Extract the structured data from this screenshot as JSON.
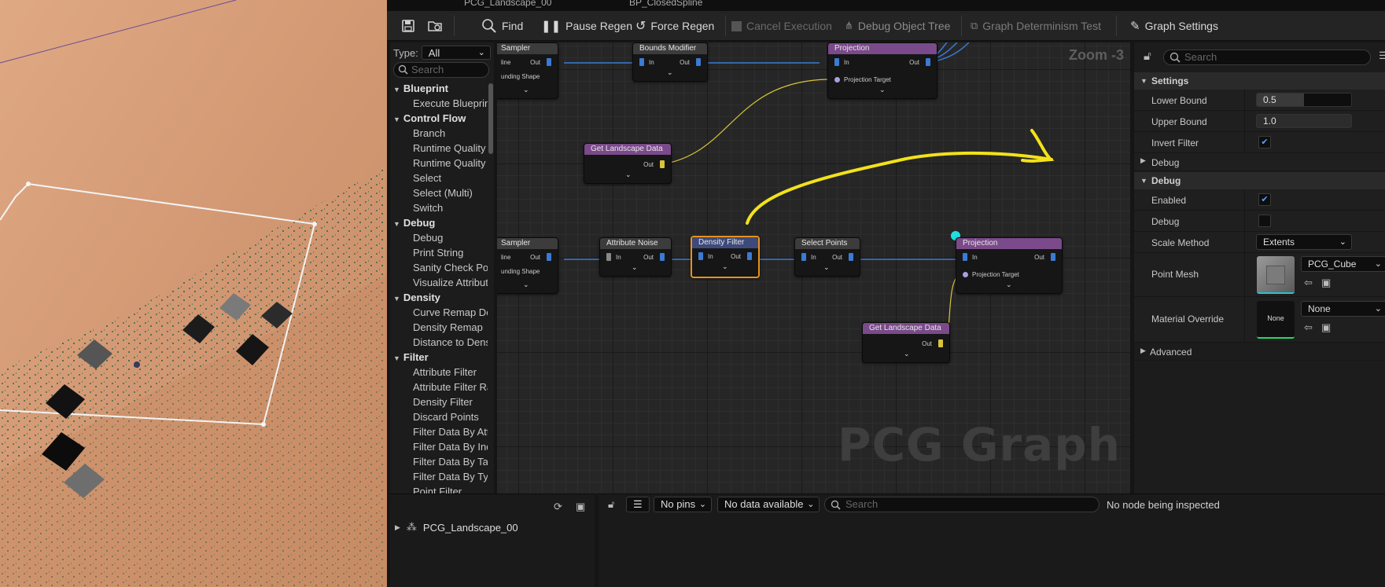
{
  "tabs": [
    {
      "label": "PCG_Landscape_00"
    },
    {
      "label": "BP_ClosedSpline"
    }
  ],
  "toolbar": {
    "find": "Find",
    "pause_regen": "Pause Regen",
    "force_regen": "Force Regen",
    "cancel_execution": "Cancel Execution",
    "debug_object_tree": "Debug Object Tree",
    "graph_determinism_test": "Graph Determinism Test",
    "graph_settings": "Graph Settings"
  },
  "palette": {
    "type_label": "Type:",
    "type_value": "All",
    "search_placeholder": "Search",
    "rows": [
      {
        "kind": "cat",
        "label": "Blueprint"
      },
      {
        "kind": "item",
        "label": "Execute Blueprint"
      },
      {
        "kind": "cat",
        "label": "Control Flow"
      },
      {
        "kind": "item",
        "label": "Branch"
      },
      {
        "kind": "item",
        "label": "Runtime Quality Branch"
      },
      {
        "kind": "item",
        "label": "Runtime Quality Select"
      },
      {
        "kind": "item",
        "label": "Select"
      },
      {
        "kind": "item",
        "label": "Select (Multi)"
      },
      {
        "kind": "item",
        "label": "Switch"
      },
      {
        "kind": "cat",
        "label": "Debug"
      },
      {
        "kind": "item",
        "label": "Debug"
      },
      {
        "kind": "item",
        "label": "Print String"
      },
      {
        "kind": "item",
        "label": "Sanity Check Point Data"
      },
      {
        "kind": "item",
        "label": "Visualize Attribute"
      },
      {
        "kind": "cat",
        "label": "Density"
      },
      {
        "kind": "item",
        "label": "Curve Remap Density"
      },
      {
        "kind": "item",
        "label": "Density Remap"
      },
      {
        "kind": "item",
        "label": "Distance to Density"
      },
      {
        "kind": "cat",
        "label": "Filter"
      },
      {
        "kind": "item",
        "label": "Attribute Filter"
      },
      {
        "kind": "item",
        "label": "Attribute Filter Range"
      },
      {
        "kind": "item",
        "label": "Density Filter"
      },
      {
        "kind": "item",
        "label": "Discard Points"
      },
      {
        "kind": "item",
        "label": "Filter Data By Attribute"
      },
      {
        "kind": "item",
        "label": "Filter Data By Index"
      },
      {
        "kind": "item",
        "label": "Filter Data By Tag"
      },
      {
        "kind": "item",
        "label": "Filter Data By Type"
      },
      {
        "kind": "item",
        "label": "Point Filter"
      }
    ]
  },
  "graph": {
    "zoom": "Zoom -3",
    "watermark": "PCG Graph",
    "nodes": {
      "sampler_top": {
        "title": "Sampler",
        "pin_in": "line",
        "pin_out": "Out",
        "pin2": "unding Shape"
      },
      "bounds_modifier": {
        "title": "Bounds Modifier",
        "pin_in": "In",
        "pin_out": "Out"
      },
      "projection_top": {
        "title": "Projection",
        "pin_in": "In",
        "pin_out": "Out",
        "pin2": "Projection Target"
      },
      "get_landscape_top": {
        "title": "Get Landscape Data",
        "pin_out": "Out"
      },
      "sampler_bottom": {
        "title": "Sampler",
        "pin_in": "line",
        "pin_out": "Out",
        "pin2": "unding Shape"
      },
      "attribute_noise": {
        "title": "Attribute Noise",
        "pin_in": "In",
        "pin_out": "Out"
      },
      "density_filter": {
        "title": "Density Filter",
        "pin_in": "In",
        "pin_out": "Out"
      },
      "select_points": {
        "title": "Select Points",
        "pin_in": "In",
        "pin_out": "Out"
      },
      "projection_bottom": {
        "title": "Projection",
        "pin_in": "In",
        "pin_out": "Out",
        "pin2": "Projection Target"
      },
      "get_landscape_bottom": {
        "title": "Get Landscape Data",
        "pin_out": "Out"
      }
    }
  },
  "details": {
    "search_placeholder": "Search",
    "settings_header": "Settings",
    "lower_bound_label": "Lower Bound",
    "lower_bound_value": "0.5",
    "lower_bound_fraction": 0.5,
    "upper_bound_label": "Upper Bound",
    "upper_bound_value": "1.0",
    "invert_filter_label": "Invert Filter",
    "invert_filter_checked": true,
    "debug_sub_label": "Debug",
    "debug_header": "Debug",
    "enabled_label": "Enabled",
    "enabled_checked": true,
    "debug_label": "Debug",
    "debug_checked": false,
    "scale_method_label": "Scale Method",
    "scale_method_value": "Extents",
    "point_mesh_label": "Point Mesh",
    "point_mesh_value": "PCG_Cube",
    "material_override_label": "Material Override",
    "material_override_value": "None",
    "material_thumb_text": "None",
    "advanced_label": "Advanced"
  },
  "outliner": {
    "item": "PCG_Landscape_00"
  },
  "inspector": {
    "pins_dropdown": "No pins",
    "data_dropdown": "No data available",
    "search_placeholder": "Search",
    "status": "No node being inspected"
  },
  "colors": {
    "accent_blue": "#3a7bd5",
    "selected_orange": "#e8911e",
    "annotation_yellow": "#f2e21a",
    "node_header_purple": "#7a4a8a",
    "node_header_grey": "#3c3c3c"
  }
}
